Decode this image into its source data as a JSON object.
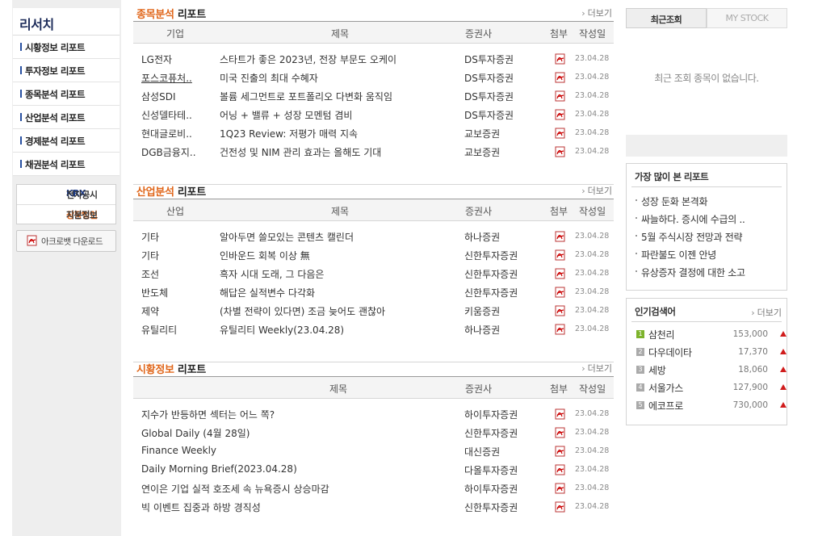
{
  "sidebar": {
    "title": "리서치",
    "menu": [
      "시황정보 리포트",
      "투자정보 리포트",
      "종목분석 리포트",
      "산업분석 리포트",
      "경제분석 리포트",
      "채권분석 리포트"
    ],
    "krx_prefix": "KRX",
    "krx_label": "전자공시",
    "listed_prefix": "상장법인",
    "listed_label": "지분정보",
    "acrobat_label": "아크로뱃 다운로드"
  },
  "stock_section": {
    "title_highlight": "종목분석",
    "title_rest": "리포트",
    "more": "더보기",
    "headers": [
      "기업",
      "제목",
      "증권사",
      "첨부",
      "작성일"
    ],
    "rows": [
      {
        "name": "LG전자",
        "title": "스타트가 좋은 2023년, 전장 부문도 오케이",
        "broker": "DS투자증권",
        "date": "23.04.28"
      },
      {
        "name": "포스코퓨처..",
        "title": "미국 진출의 최대 수혜자",
        "broker": "DS투자증권",
        "date": "23.04.28"
      },
      {
        "name": "삼성SDI",
        "title": "볼륨 세그먼트로 포트폴리오 다변화 움직임",
        "broker": "DS투자증권",
        "date": "23.04.28"
      },
      {
        "name": "신성델타테..",
        "title": "어닝 + 밸류 + 성장 모멘텀 겸비",
        "broker": "DS투자증권",
        "date": "23.04.28"
      },
      {
        "name": "현대글로비..",
        "title": "1Q23 Review: 저평가 매력 지속",
        "broker": "교보증권",
        "date": "23.04.28"
      },
      {
        "name": "DGB금융지..",
        "title": "건전성 및 NIM 관리 효과는 올해도 기대",
        "broker": "교보증권",
        "date": "23.04.28"
      }
    ]
  },
  "industry_section": {
    "title_highlight": "산업분석",
    "title_rest": "리포트",
    "more": "더보기",
    "headers": [
      "산업",
      "제목",
      "증권사",
      "첨부",
      "작성일"
    ],
    "rows": [
      {
        "name": "기타",
        "title": "알아두면 쓸모있는 콘텐츠 캘린더",
        "broker": "하나증권",
        "date": "23.04.28"
      },
      {
        "name": "기타",
        "title": "인바운드 회복 이상 無",
        "broker": "신한투자증권",
        "date": "23.04.28"
      },
      {
        "name": "조선",
        "title": "흑자 시대 도래, 그 다음은",
        "broker": "신한투자증권",
        "date": "23.04.28"
      },
      {
        "name": "반도체",
        "title": "해답은 실적변수 다각화",
        "broker": "신한투자증권",
        "date": "23.04.28"
      },
      {
        "name": "제약",
        "title": "(차별 전략이 있다면) 조금 늦어도 괜찮아",
        "broker": "키움증권",
        "date": "23.04.28"
      },
      {
        "name": "유틸리티",
        "title": "유틸리티 Weekly(23.04.28)",
        "broker": "하나증권",
        "date": "23.04.28"
      }
    ]
  },
  "market_section": {
    "title_highlight": "시황정보",
    "title_rest": "리포트",
    "more": "더보기",
    "headers": [
      "제목",
      "증권사",
      "첨부",
      "작성일"
    ],
    "rows": [
      {
        "title": "지수가 반등하면 섹터는 어느 쪽?",
        "broker": "하이투자증권",
        "date": "23.04.28"
      },
      {
        "title": "Global Daily (4월 28일)",
        "broker": "신한투자증권",
        "date": "23.04.28"
      },
      {
        "title": "Finance Weekly",
        "broker": "대신증권",
        "date": "23.04.28"
      },
      {
        "title": "Daily Morning Brief(2023.04.28)",
        "broker": "다올투자증권",
        "date": "23.04.28"
      },
      {
        "title": "연이은 기업 실적 호조세 속 뉴욕증시 상승마감",
        "broker": "하이투자증권",
        "date": "23.04.28"
      },
      {
        "title": "빅 이벤트 집중과 하방 경직성",
        "broker": "신한투자증권",
        "date": "23.04.28"
      }
    ]
  },
  "right_panel": {
    "tab_recent": "최근조회",
    "tab_mystock": "MY STOCK",
    "recent_empty": "최근 조회 종목이 없습니다.",
    "popular_title": "가장 많이 본 리포트",
    "popular": [
      "성장 둔화 본격화",
      "싸늘하다. 증시에 수급의 ..",
      "5월 주식시장 전망과 전략",
      "파란불도 이젠 안녕",
      "유상증자 결정에 대한 소고"
    ],
    "search_title": "인기검색어",
    "search_more": "더보기",
    "search": [
      {
        "rank": "1",
        "name": "삼천리",
        "value": "153,000"
      },
      {
        "rank": "2",
        "name": "다우데이타",
        "value": "17,370"
      },
      {
        "rank": "3",
        "name": "세방",
        "value": "18,060"
      },
      {
        "rank": "4",
        "name": "서울가스",
        "value": "127,900"
      },
      {
        "rank": "5",
        "name": "에코프로",
        "value": "730,000"
      }
    ]
  },
  "colors": {
    "accent": "#e0661a",
    "navy": "#1d2c5a",
    "up": "#d01c1c",
    "rank_first": "#7db32c"
  },
  "icons": {
    "attachment": "pdf-icon",
    "up": "triangle-up-icon"
  }
}
